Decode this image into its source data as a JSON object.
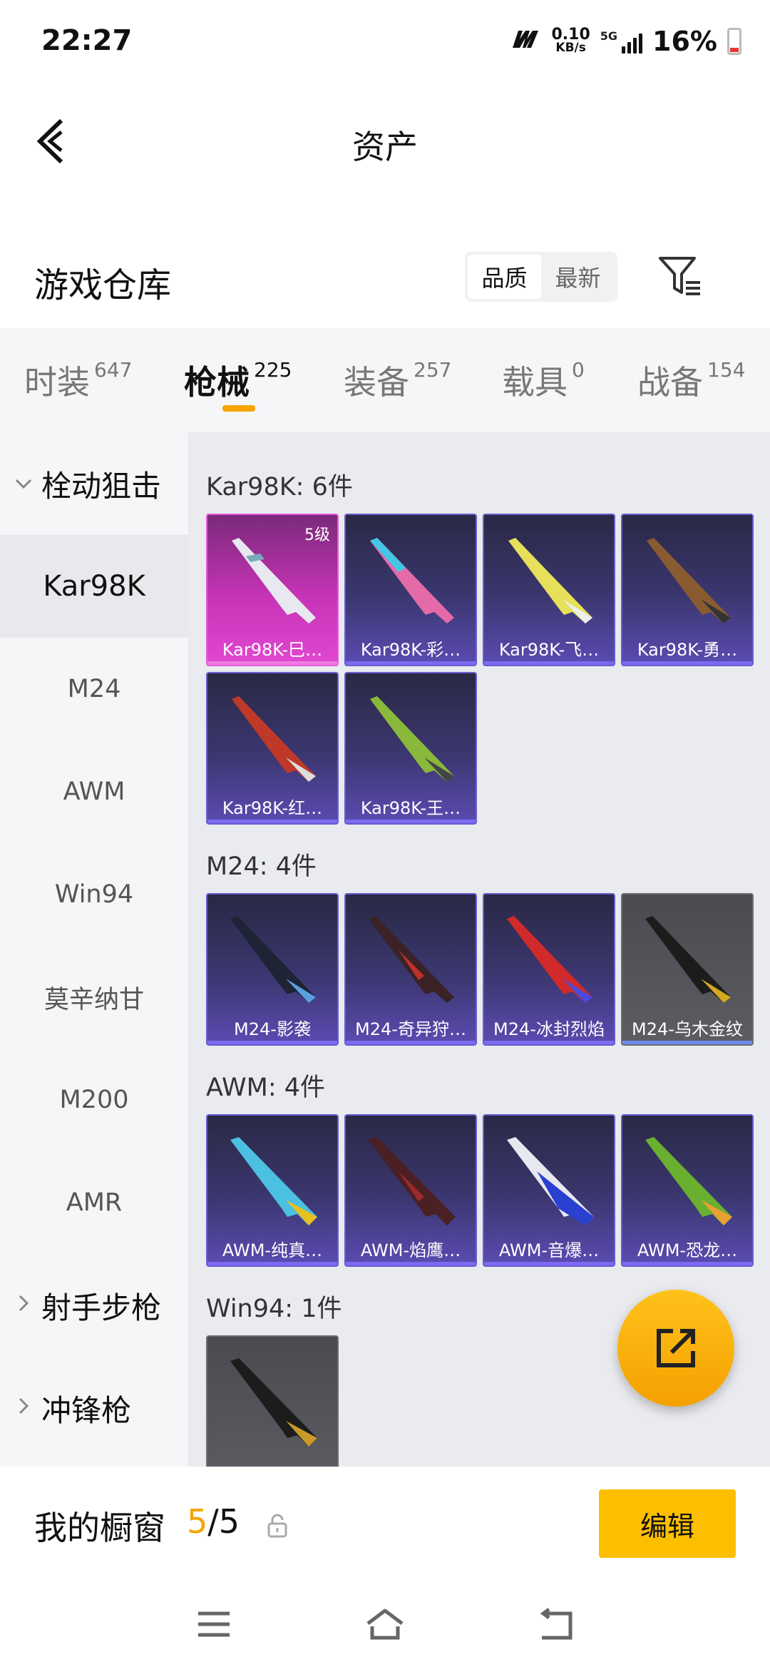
{
  "status": {
    "time": "22:27",
    "carrier_logo": "m",
    "net_speed_value": "0.10",
    "net_speed_unit": "KB/s",
    "signal_label": "5G",
    "battery_pct": "16%",
    "battery_color": "#e53935"
  },
  "header": {
    "title": "资产",
    "back_icon": "chevron-left-icon"
  },
  "warehouse": {
    "title": "游戏仓库",
    "sort_options": [
      "品质",
      "最新"
    ],
    "sort_selected": "品质",
    "filter_icon": "filter-icon"
  },
  "tabs": [
    {
      "label": "时装",
      "count": "647"
    },
    {
      "label": "枪械",
      "count": "225"
    },
    {
      "label": "装备",
      "count": "257"
    },
    {
      "label": "载具",
      "count": "0"
    },
    {
      "label": "战备",
      "count": "154"
    }
  ],
  "active_tab": "枪械",
  "accent_color": "#f5a400",
  "sidebar": {
    "groups": [
      {
        "label": "栓动狙击",
        "expanded": true,
        "items": [
          "Kar98K",
          "M24",
          "AWM",
          "Win94",
          "莫辛纳甘",
          "M200",
          "AMR"
        ]
      },
      {
        "label": "射手步枪",
        "expanded": false
      },
      {
        "label": "冲锋枪",
        "expanded": false
      }
    ],
    "active_item": "Kar98K"
  },
  "groups": [
    {
      "title": "Kar98K: 6件",
      "items": [
        {
          "name": "Kar98K-巳…",
          "rarity": "pink",
          "level": "5级"
        },
        {
          "name": "Kar98K-彩…",
          "rarity": "purple"
        },
        {
          "name": "Kar98K-飞…",
          "rarity": "purple"
        },
        {
          "name": "Kar98K-勇…",
          "rarity": "purple"
        },
        {
          "name": "Kar98K-红…",
          "rarity": "purple"
        },
        {
          "name": "Kar98K-王…",
          "rarity": "purple"
        }
      ]
    },
    {
      "title": "M24: 4件",
      "items": [
        {
          "name": "M24-影袭",
          "rarity": "purple"
        },
        {
          "name": "M24-奇异狩…",
          "rarity": "purple"
        },
        {
          "name": "M24-冰封烈焰",
          "rarity": "purple"
        },
        {
          "name": "M24-乌木金纹",
          "rarity": "gray"
        }
      ]
    },
    {
      "title": "AWM: 4件",
      "items": [
        {
          "name": "AWM-纯真…",
          "rarity": "purple"
        },
        {
          "name": "AWM-焰鹰…",
          "rarity": "purple"
        },
        {
          "name": "AWM-音爆…",
          "rarity": "purple"
        },
        {
          "name": "AWM-恐龙…",
          "rarity": "purple"
        }
      ]
    },
    {
      "title": "Win94: 1件",
      "items": [
        {
          "name": "",
          "rarity": "gray"
        }
      ]
    }
  ],
  "fab_icon": "share-external-icon",
  "showcase": {
    "label": "我的橱窗",
    "current": "5",
    "separator": "/",
    "total": "5",
    "lock_icon": "lock-icon",
    "edit_label": "编辑"
  },
  "nav": [
    "menu-icon",
    "home-icon",
    "back-icon"
  ]
}
